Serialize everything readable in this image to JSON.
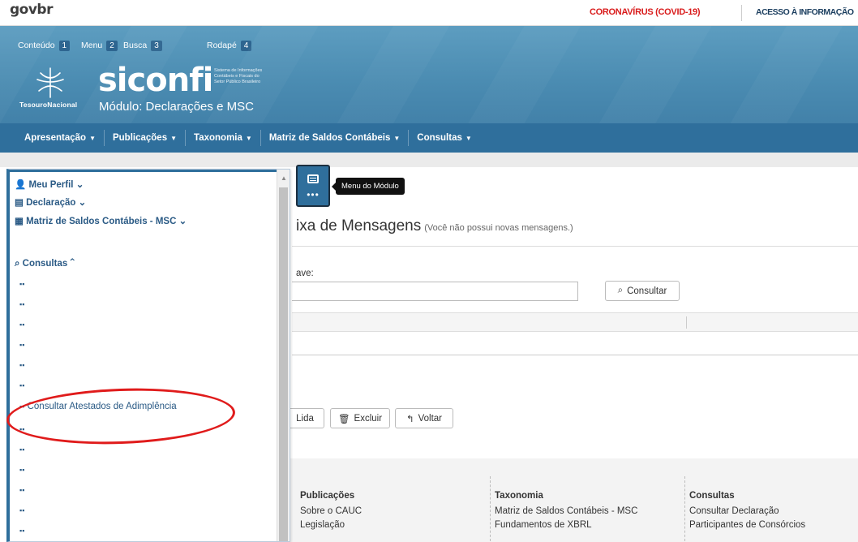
{
  "govbar": {
    "logo": "govbr",
    "covid": "CORONAVÍRUS (COVID-19)",
    "acesso": "ACESSO À INFORMAÇÃO"
  },
  "skip_links": [
    {
      "label": "Conteúdo",
      "num": "1"
    },
    {
      "label": "Menu",
      "num": "2"
    },
    {
      "label": "Busca",
      "num": "3"
    },
    {
      "label": "Rodapé",
      "num": "4"
    }
  ],
  "brand": {
    "tesouro": "TesouroNacional",
    "siconfi": "siconfi",
    "siconfi_sub": "Sistema de Informações Contábeis e Fiscais do Setor Público Brasileiro",
    "modulo": "Módulo: Declarações e MSC"
  },
  "nav": [
    "Apresentação",
    "Publicações",
    "Taxonomia",
    "Matriz de Saldos Contábeis",
    "Consultas"
  ],
  "sidebar": {
    "meu_perfil": "Meu Perfil",
    "declaracao": "Declaração",
    "msc": "Matriz de Saldos Contábeis - MSC",
    "consultas": "Consultas",
    "highlighted": "Consultar Atestados de Adimplência"
  },
  "menu_toggle": {
    "tooltip": "Menu do Módulo",
    "dots": "•••"
  },
  "page": {
    "title": "ixa de Mensagens",
    "subtitle": "(Você não possui novas mensagens.)",
    "field_label": "ave:",
    "consultar": "Consultar",
    "lida": "Lida",
    "excluir": "Excluir",
    "voltar": "Voltar"
  },
  "footer": {
    "col1": {
      "header": "Publicações",
      "items": [
        "Sobre o CAUC",
        "Legislação"
      ]
    },
    "col2": {
      "header": "Taxonomia",
      "items": [
        "Matriz de Saldos Contábeis - MSC",
        "Fundamentos de XBRL"
      ]
    },
    "col3": {
      "header": "Consultas",
      "items": [
        "Consultar Declaração",
        "Participantes de Consórcios"
      ]
    }
  },
  "colors": {
    "header_blue": "#4a8bb1",
    "nav_blue": "#2f6f9c",
    "annotation_red": "#e01b1b",
    "covid_red": "#d91c1c"
  }
}
